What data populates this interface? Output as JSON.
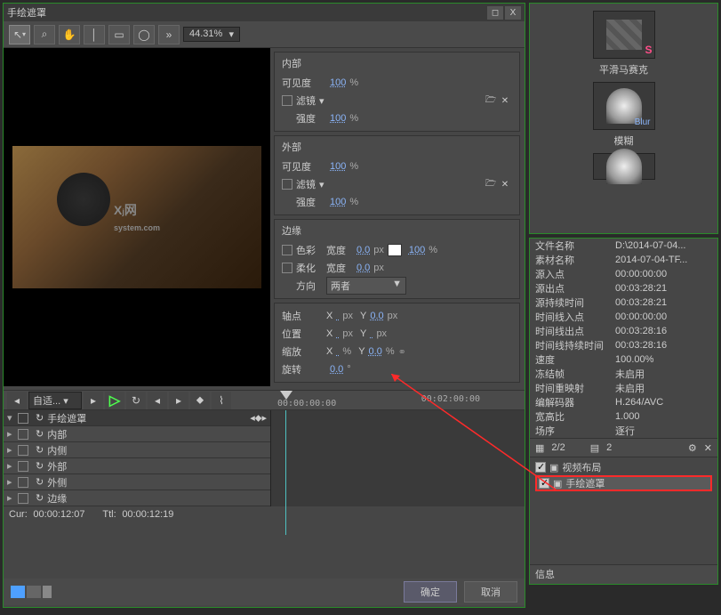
{
  "window": {
    "title": "手绘遮罩",
    "detach": "◻",
    "close": "X"
  },
  "toolbar": {
    "zoom": "44.31%",
    "zoom_caret": "▾"
  },
  "groups": {
    "inner": {
      "title": "内部",
      "visibility_label": "可见度",
      "visibility_val": "100",
      "pct": "%",
      "filter_label": "滤镜",
      "filter_caret": "▾",
      "intensity_label": "强度",
      "intensity_val": "100"
    },
    "outer": {
      "title": "外部",
      "visibility_label": "可见度",
      "visibility_val": "100",
      "pct": "%",
      "filter_label": "滤镜",
      "filter_caret": "▾",
      "intensity_label": "强度",
      "intensity_val": "100"
    },
    "edge": {
      "title": "边缘",
      "color_label": "色彩",
      "width_label": "宽度",
      "width_val": "0.0",
      "px": "px",
      "pct_val": "100",
      "pct": "%",
      "soft_label": "柔化",
      "soft_width_val": "0.0",
      "dir_label": "方向",
      "dir_val": "两者",
      "dir_caret": "▼"
    },
    "transform": {
      "pivot_label": "轴点",
      "x": "X",
      "y": "Y",
      "px": "px",
      "pct": "%",
      "deg": "°",
      "pos_label": "位置",
      "scale_label": "缩放",
      "scale_val": "0.0",
      "rot_label": "旋转",
      "rot_val": "0.0"
    }
  },
  "timeline": {
    "dropdown": "自适...",
    "mark1": "00:00:00:00",
    "mark2": "00:02:00:00",
    "tracks": {
      "root": "手绘遮罩",
      "t1": "内部",
      "t2": "内侧",
      "t3": "外部",
      "t4": "外侧",
      "t5": "边缘"
    }
  },
  "status": {
    "cur_label": "Cur:",
    "cur_val": "00:00:12:07",
    "ttl_label": "Ttl:",
    "ttl_val": "00:00:12:19"
  },
  "buttons": {
    "ok": "确定",
    "cancel": "取消"
  },
  "fx": {
    "mosaic_name": "平滑马赛克",
    "blur_en": "Blur",
    "blur_name": "模糊"
  },
  "info": {
    "rows": [
      {
        "k": "文件名称",
        "v": "D:\\2014-07-04..."
      },
      {
        "k": "素材名称",
        "v": "2014-07-04-TF..."
      },
      {
        "k": "源入点",
        "v": "00:00:00:00"
      },
      {
        "k": "源出点",
        "v": "00:03:28:21"
      },
      {
        "k": "源持续时间",
        "v": "00:03:28:21"
      },
      {
        "k": "时间线入点",
        "v": "00:00:00:00"
      },
      {
        "k": "时间线出点",
        "v": "00:03:28:16"
      },
      {
        "k": "时间线持续时间",
        "v": "00:03:28:16"
      },
      {
        "k": "速度",
        "v": "100.00%"
      },
      {
        "k": "冻结帧",
        "v": "未启用"
      },
      {
        "k": "时间重映射",
        "v": "未启用"
      },
      {
        "k": "编解码器",
        "v": "H.264/AVC"
      },
      {
        "k": "宽高比",
        "v": "1.000"
      },
      {
        "k": "场序",
        "v": "逐行"
      }
    ],
    "footer": "信息"
  },
  "layers": {
    "page": "2/2",
    "count": "2",
    "l1": "视频布局",
    "l2": "手绘遮罩"
  }
}
